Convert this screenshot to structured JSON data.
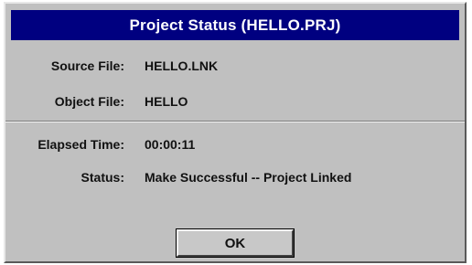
{
  "dialog": {
    "title": "Project Status (HELLO.PRJ)",
    "fields": [
      {
        "label": "Source File:",
        "value": "HELLO.LNK"
      },
      {
        "label": "Object File:",
        "value": "HELLO"
      },
      {
        "label": "Elapsed Time:",
        "value": "00:00:11"
      },
      {
        "label": "Status:",
        "value": "Make Successful -- Project Linked"
      }
    ],
    "ok_label": "OK"
  },
  "colors": {
    "titlebar": "#000080",
    "dialog_bg": "#c0c0c0"
  }
}
